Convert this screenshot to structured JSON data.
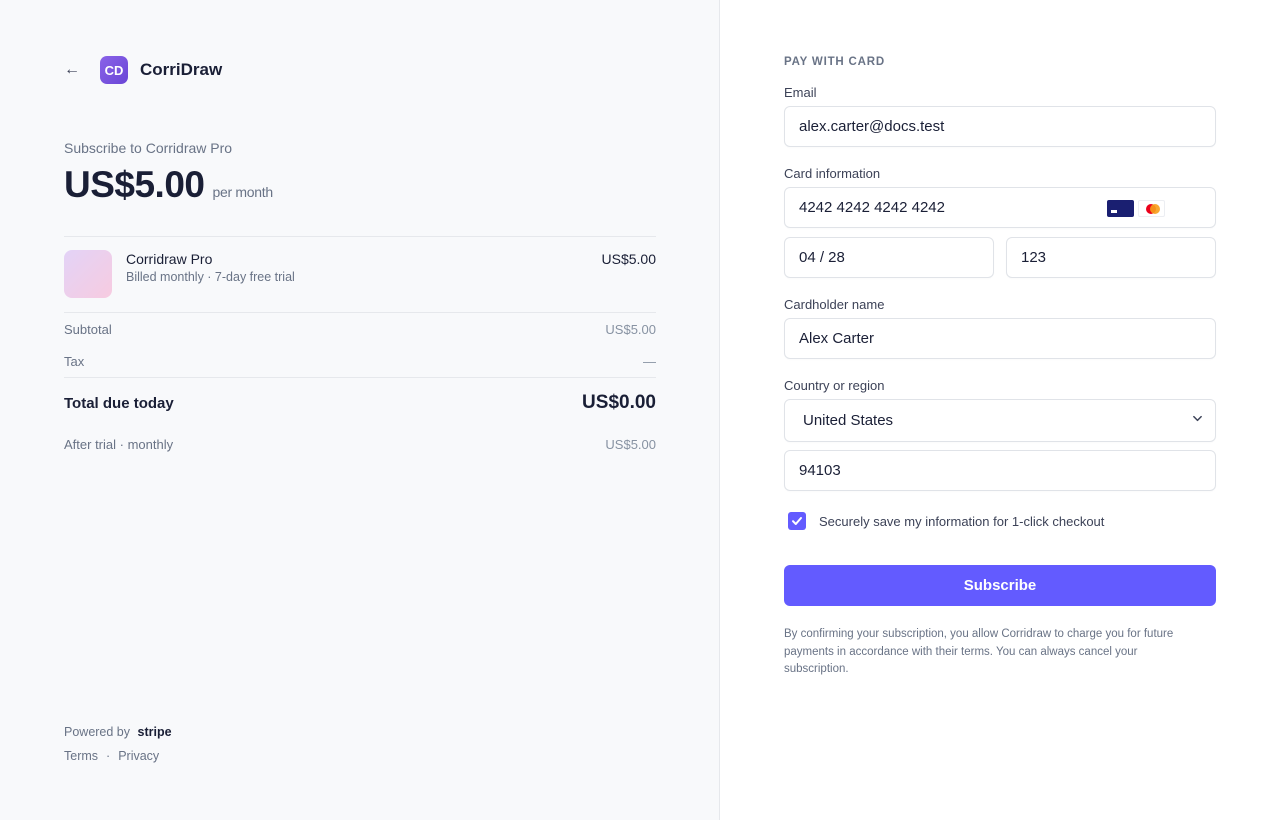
{
  "merchant": {
    "back_icon": "arrow-left-icon",
    "logo_text": "CD",
    "name": "CorriDraw"
  },
  "summary": {
    "subscribe_title": "Subscribe to Corridraw Pro",
    "price": "US$5.00",
    "period": "per month",
    "item": {
      "name": "Corridraw Pro",
      "meta": "Billed monthly · 7-day free trial",
      "price": "US$5.00"
    },
    "subtotal_label": "Subtotal",
    "subtotal_value": "US$5.00",
    "tax_label": "Tax",
    "tax_value": "—",
    "total_label": "Total due today",
    "total_value": "US$0.00",
    "after_trial_label": "After trial · monthly",
    "after_trial_value": "US$5.00"
  },
  "footer": {
    "powered_by": "Powered by",
    "stripe": "stripe",
    "terms": "Terms",
    "separator": "·",
    "privacy": "Privacy"
  },
  "form": {
    "section_title": "PAY WITH CARD",
    "email_label": "Email",
    "email_value": "alex.carter@docs.test",
    "card_label": "Card information",
    "card_number": "4242 4242 4242 4242",
    "expiry": "04 / 28",
    "cvc": "123",
    "card_brands": [
      "visa-icon",
      "mastercard-icon"
    ],
    "name_label": "Cardholder name",
    "name_value": "Alex Carter",
    "country_label": "Country or region",
    "country_value": "United States",
    "zip_value": "94103",
    "save_info_checked": true,
    "save_info_label": "Securely save my information for 1-click checkout",
    "subscribe_label": "Subscribe",
    "disclaimer": "By confirming your subscription, you allow Corridraw to charge you for future payments in accordance with their terms. You can always cancel your subscription."
  },
  "colors": {
    "accent": "#635bff",
    "text_primary": "#1a1f36",
    "text_secondary": "#697386",
    "left_bg": "#f8f9fb"
  }
}
